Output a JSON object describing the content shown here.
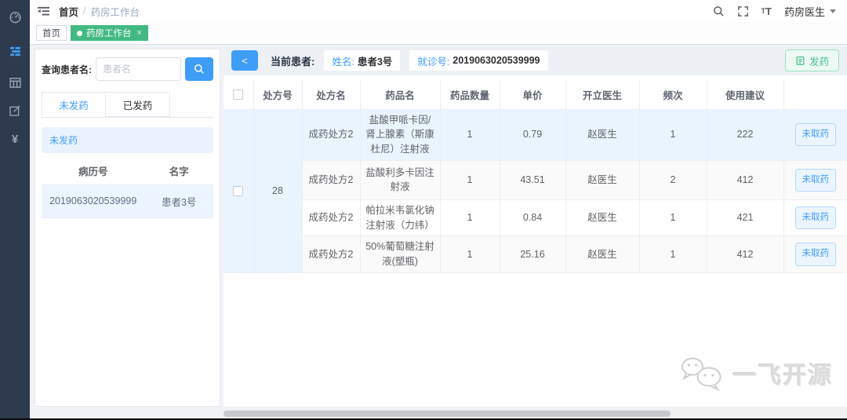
{
  "colors": {
    "accent_blue": "#409eff",
    "accent_green": "#42b983",
    "sidebar_bg": "#2e3a4e",
    "selected_row": "#ecf5ff"
  },
  "icons": {
    "sidebar": [
      "dashboard-icon",
      "menu-list-icon (active)",
      "grid-table-icon",
      "edit-compose-icon",
      "currency-yuan-icon"
    ],
    "header": [
      "fold-menu-icon",
      "search-icon",
      "fullscreen-icon",
      "font-size-icon",
      "caret-down-icon"
    ]
  },
  "header": {
    "breadcrumb_home": "首页",
    "breadcrumb_sep": "/",
    "breadcrumb_current": "药房工作台",
    "font_icon_small": "T",
    "font_icon_big": "T",
    "user_name": "药房医生"
  },
  "tagbar": {
    "home_tab": "首页",
    "active_tab": "药房工作台",
    "close_symbol": "×"
  },
  "left_panel": {
    "search_label": "查询患者名:",
    "search_placeholder": "患者名",
    "tab_pending": "未发药",
    "tab_done": "已发药",
    "alert": "未发药",
    "table": {
      "header_record_no": "病历号",
      "header_name": "名字",
      "row": {
        "record_no": "2019063020539999",
        "name": "患者3号"
      }
    }
  },
  "main": {
    "toolbar": {
      "back_symbol": "<",
      "current_patient_label": "当前患者:",
      "name_label": "姓名:",
      "name_value": "患者3号",
      "visit_label": "就诊号:",
      "visit_value": "2019063020539999",
      "dispense_label": "发药"
    },
    "table": {
      "headers": [
        "处方号",
        "处方名",
        "药品名",
        "药品数量",
        "单价",
        "开立医生",
        "频次",
        "使用建议"
      ],
      "prescription_no": "28",
      "rows": [
        {
          "prescription_name": "成药处方2",
          "drug_name": "盐酸甲哌卡因/肾上腺素（斯康杜尼）注射液",
          "quantity": "1",
          "unit_price": "0.79",
          "doctor": "赵医生",
          "frequency": "1",
          "usage_advice": "222",
          "action": "未取药"
        },
        {
          "prescription_name": "成药处方2",
          "drug_name": "盐酸利多卡因注射液",
          "quantity": "1",
          "unit_price": "43.51",
          "doctor": "赵医生",
          "frequency": "2",
          "usage_advice": "412",
          "action": "未取药"
        },
        {
          "prescription_name": "成药处方2",
          "drug_name": "帕拉米韦氯化钠注射液（力纬）",
          "quantity": "1",
          "unit_price": "0.84",
          "doctor": "赵医生",
          "frequency": "1",
          "usage_advice": "421",
          "action": "未取药"
        },
        {
          "prescription_name": "成药处方2",
          "drug_name": "50%葡萄糖注射液(塑瓶)",
          "quantity": "1",
          "unit_price": "25.16",
          "doctor": "赵医生",
          "frequency": "1",
          "usage_advice": "412",
          "action": "未取药"
        }
      ]
    }
  },
  "watermark": {
    "text": "一飞开源"
  }
}
